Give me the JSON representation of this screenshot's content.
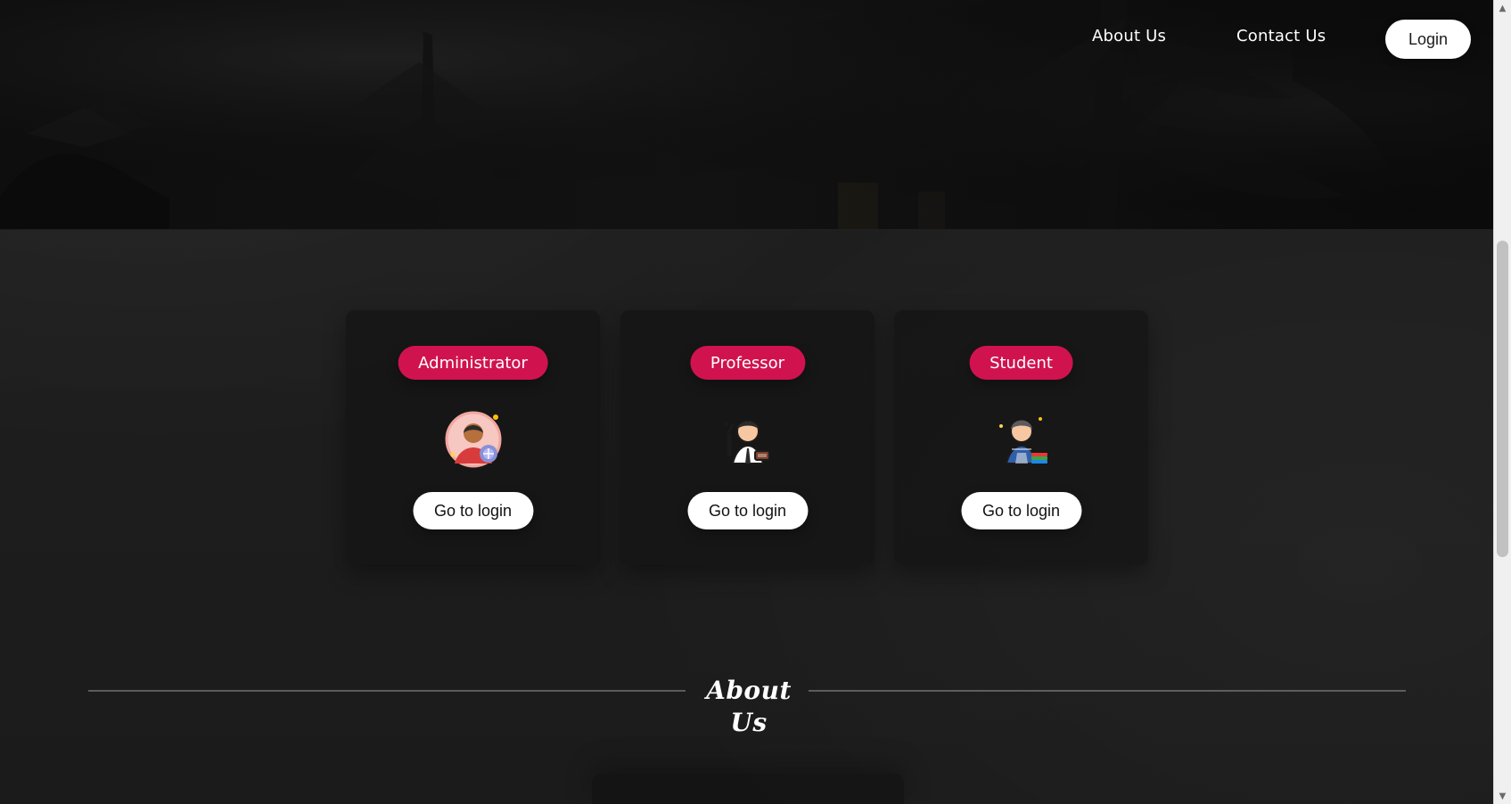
{
  "nav": {
    "about_label": "About Us",
    "contact_label": "Contact Us",
    "login_label": "Login"
  },
  "cards": [
    {
      "role_label": "Administrator",
      "button_label": "Go to login",
      "icon": "admin-avatar-icon"
    },
    {
      "role_label": "Professor",
      "button_label": "Go to login",
      "icon": "professor-avatar-icon"
    },
    {
      "role_label": "Student",
      "button_label": "Go to login",
      "icon": "student-avatar-icon"
    }
  ],
  "about": {
    "title": "About Us"
  },
  "colors": {
    "accent": "#d0134f",
    "button_bg": "#ffffff",
    "page_bg": "#1f1f1f"
  },
  "scrollbar": {
    "up_icon": "scroll-up-icon",
    "down_icon": "scroll-down-icon"
  }
}
